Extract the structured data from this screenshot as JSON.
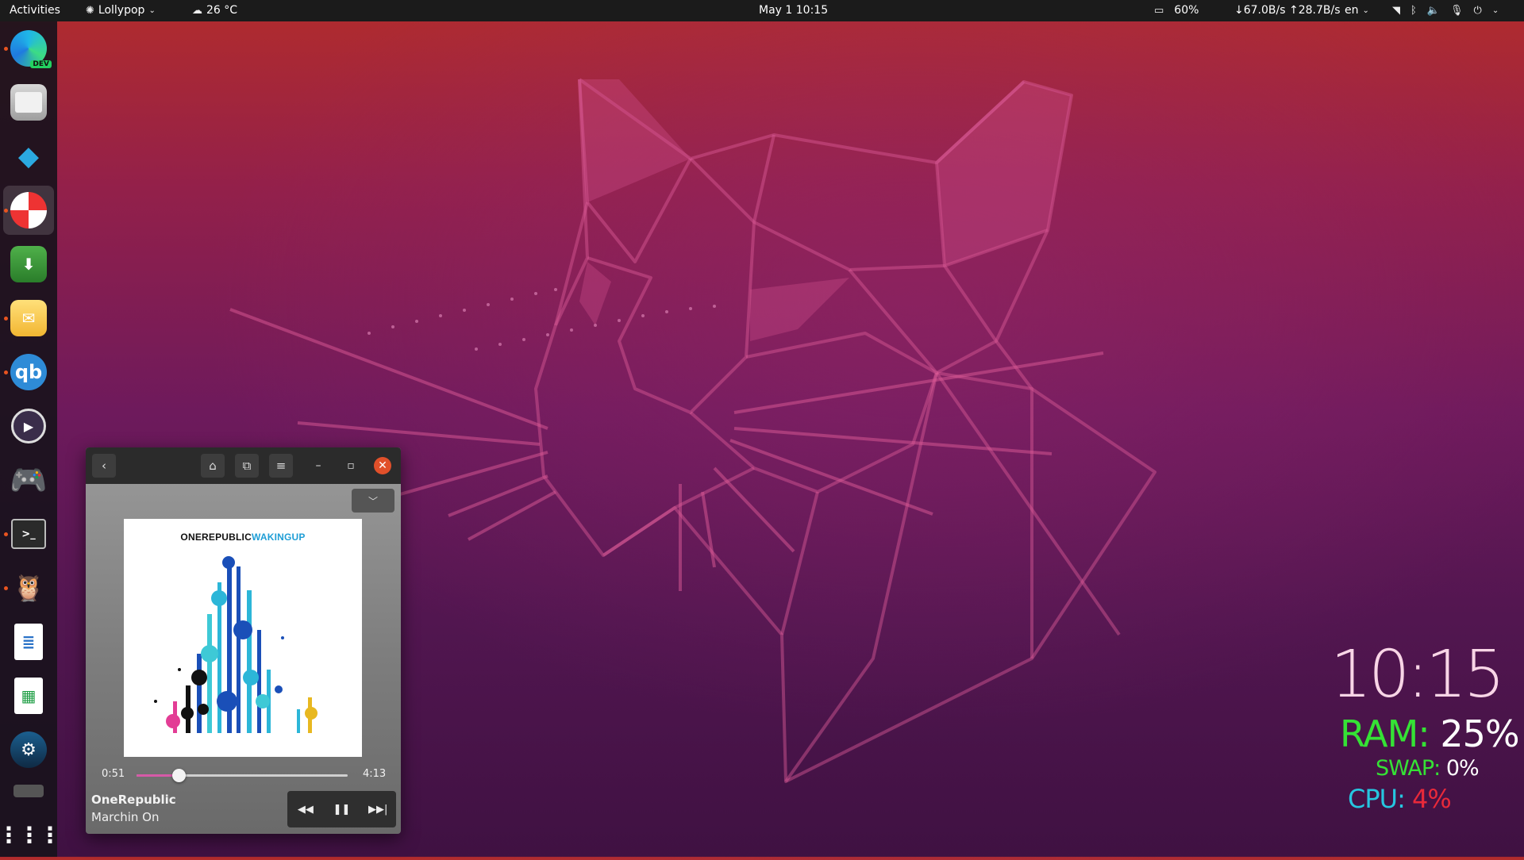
{
  "topbar": {
    "activities": "Activities",
    "app_menu": "Lollypop",
    "weather": "26 °C",
    "clock": "May 1  10:15",
    "battery": "60%",
    "netspeed": "↓67.0B/s ↑28.7B/s",
    "keyboard_layout": "en"
  },
  "dock": {
    "apps": [
      {
        "name": "Microsoft Edge Dev",
        "badge": "DEV"
      },
      {
        "name": "Files"
      },
      {
        "name": "Kodi"
      },
      {
        "name": "Lollypop"
      },
      {
        "name": "Downloader"
      },
      {
        "name": "Mail"
      },
      {
        "name": "qBittorrent",
        "label": "qb"
      },
      {
        "name": "Media Player"
      },
      {
        "name": "Game Controller"
      },
      {
        "name": "Terminal"
      },
      {
        "name": "Owl"
      },
      {
        "name": "LibreOffice Writer"
      },
      {
        "name": "LibreOffice Calc"
      },
      {
        "name": "Steam"
      },
      {
        "name": "Drive"
      },
      {
        "name": "Show Applications"
      }
    ]
  },
  "player": {
    "cover_artist": "ONEREPUBLIC",
    "cover_album": "WAKINGUP",
    "elapsed": "0:51",
    "duration": "4:13",
    "progress_fraction": 0.2,
    "artist": "OneRepublic",
    "track": "Marchin On"
  },
  "conky": {
    "time": "10:15",
    "ram_label": "RAM:",
    "ram_value": "25%",
    "swap_label": "SWAP:",
    "swap_value": "0%",
    "cpu_label": "CPU:",
    "cpu_value": "4%",
    "colors": {
      "ram_label": "#35e235",
      "swap_label": "#35e235",
      "cpu_label": "#26c6e0",
      "cpu_value": "#e8293a",
      "value": "#ffffff"
    }
  }
}
